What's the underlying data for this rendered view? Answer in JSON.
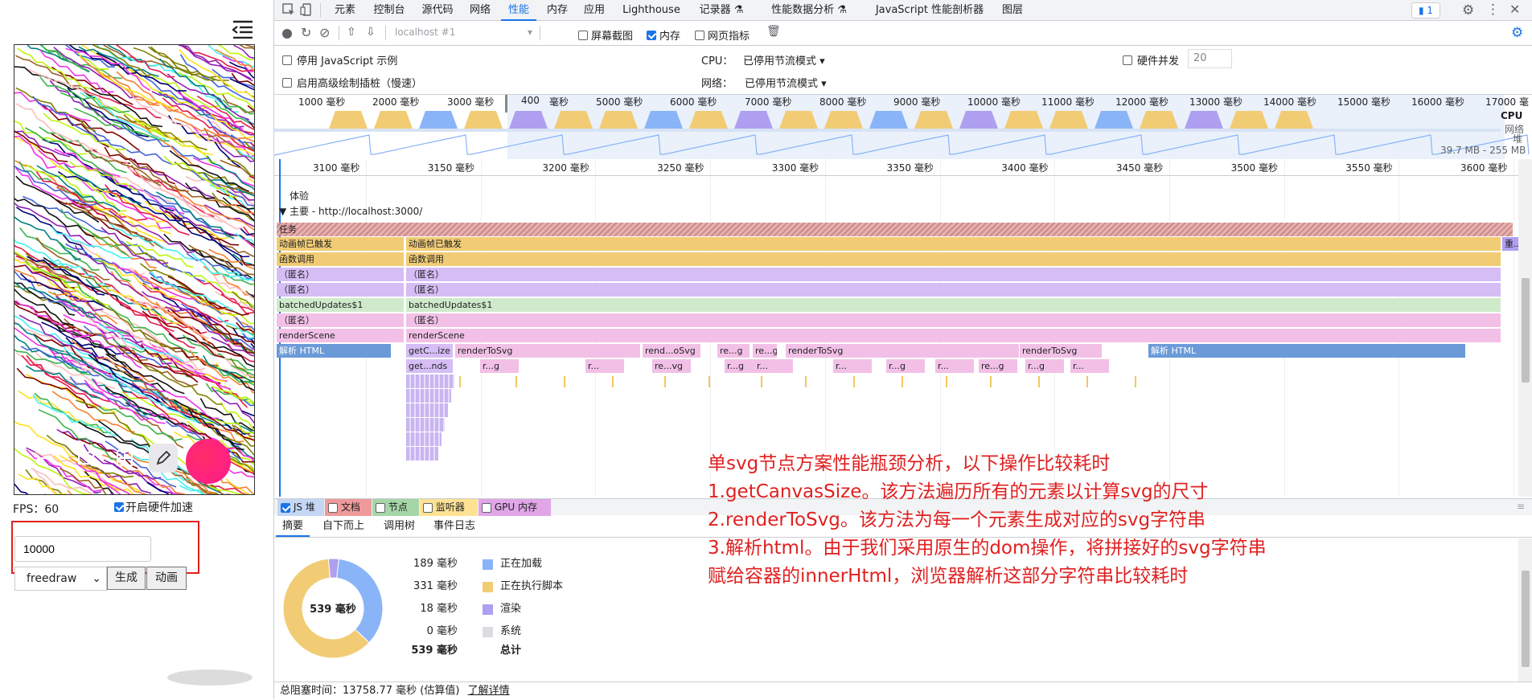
{
  "app": {
    "fps_label": "FPS：60",
    "hw_accel_label": "开启硬件加速",
    "count_input_value": "10000",
    "mode_select_value": "freedraw",
    "generate_label": "生成",
    "animate_label": "动画"
  },
  "devtools": {
    "tabs": [
      "元素",
      "控制台",
      "源代码",
      "网络",
      "性能",
      "内存",
      "应用",
      "Lighthouse",
      "记录器 ⚗",
      "性能数据分析 ⚗",
      "JavaScript 性能剖析器",
      "图层"
    ],
    "active_tab": "性能",
    "issues_badge": "1",
    "recording_select": "localhost #1",
    "checkbox_screenshot": "屏幕截图",
    "checkbox_memory": "内存",
    "checkbox_webvitals": "网页指标",
    "settings": {
      "disable_js_samples": "停用 JavaScript 示例",
      "enable_paint": "启用高级绘制插桩（慢速）",
      "cpu_label": "CPU：",
      "cpu_value": "已停用节流模式",
      "network_label": "网络：",
      "network_value": "已停用节流模式",
      "hw_concurrency_label": "硬件并发",
      "hw_concurrency_value": "20"
    },
    "overview_ticks": [
      "1000 毫秒",
      "2000 毫秒",
      "3000 毫秒",
      "400",
      "毫秒",
      "5000 毫秒",
      "6000 毫秒",
      "7000 毫秒",
      "8000 毫秒",
      "9000 毫秒",
      "10000 毫秒",
      "11000 毫秒",
      "12000 毫秒",
      "13000 毫秒",
      "14000 毫秒",
      "15000 毫秒",
      "16000 毫秒",
      "17000 毫"
    ],
    "cpu_label": "CPU",
    "net_label": "网络",
    "heap_label": "堆",
    "heap_range": "39.7 MB - 255 MB",
    "detail_ticks": [
      "3100 毫秒",
      "3150 毫秒",
      "3200 毫秒",
      "3250 毫秒",
      "3300 毫秒",
      "3350 毫秒",
      "3400 毫秒",
      "3450 毫秒",
      "3500 毫秒",
      "3550 毫秒",
      "3600 毫秒"
    ],
    "track_experience": "体验",
    "track_main": "▼ 主要 - http://localhost:3000/",
    "flame": {
      "task": "任务",
      "anim_frame": "动画帧已触发",
      "func_call": "函数调用",
      "anon": "（匿名）",
      "batched": "batchedUpdates$1",
      "render_scene": "renderScene",
      "parse_html": "解析 HTML",
      "get_canvas_size": "getC...ize",
      "get_bounds": "get...nds",
      "render_to_svg": "renderToSvg",
      "rend_svg": "rend...oSvg",
      "reg": "re...g",
      "reg2": "re...g",
      "rg": "r...g",
      "rvg": "re...vg",
      "r_dots": "r...",
      "recalc": "重...式"
    },
    "legend": [
      "JS 堆",
      "文档",
      "节点",
      "监听器",
      "GPU 内存"
    ],
    "subtabs": [
      "摘要",
      "自下而上",
      "调用树",
      "事件日志"
    ],
    "summary": {
      "total_center": "539 毫秒",
      "rows": [
        {
          "value": "189 毫秒",
          "label": "正在加载",
          "color": "#8ab4f8"
        },
        {
          "value": "331 毫秒",
          "label": "正在执行脚本",
          "color": "#f2cc75"
        },
        {
          "value": "18 毫秒",
          "label": "渲染",
          "color": "#af9ff0"
        },
        {
          "value": "0 毫秒",
          "label": "系统",
          "color": "#dadce0"
        }
      ],
      "total_value": "539 毫秒",
      "total_label": "总计"
    },
    "footer_text": "总阻塞时间：13758.77 毫秒 (估算值)",
    "footer_link": "了解详情"
  },
  "annotation": {
    "line1": "单svg节点方案性能瓶颈分析，以下操作比较耗时",
    "line2": "1.getCanvasSize。该方法遍历所有的元素以计算svg的尺寸",
    "line3": "2.renderToSvg。该方法为每一个元素生成对应的svg字符串",
    "line4": "3.解析html。由于我们采用原生的dom操作，将拼接好的svg字符串",
    "line5": "赋给容器的innerHtml，浏览器解析这部分字符串比较耗时"
  },
  "colors": {
    "active_blue": "#1a73e8",
    "scripting": "#f2cc75",
    "loading": "#8ab4f8",
    "rendering": "#af9ff0",
    "annotation_red": "#e02020"
  }
}
